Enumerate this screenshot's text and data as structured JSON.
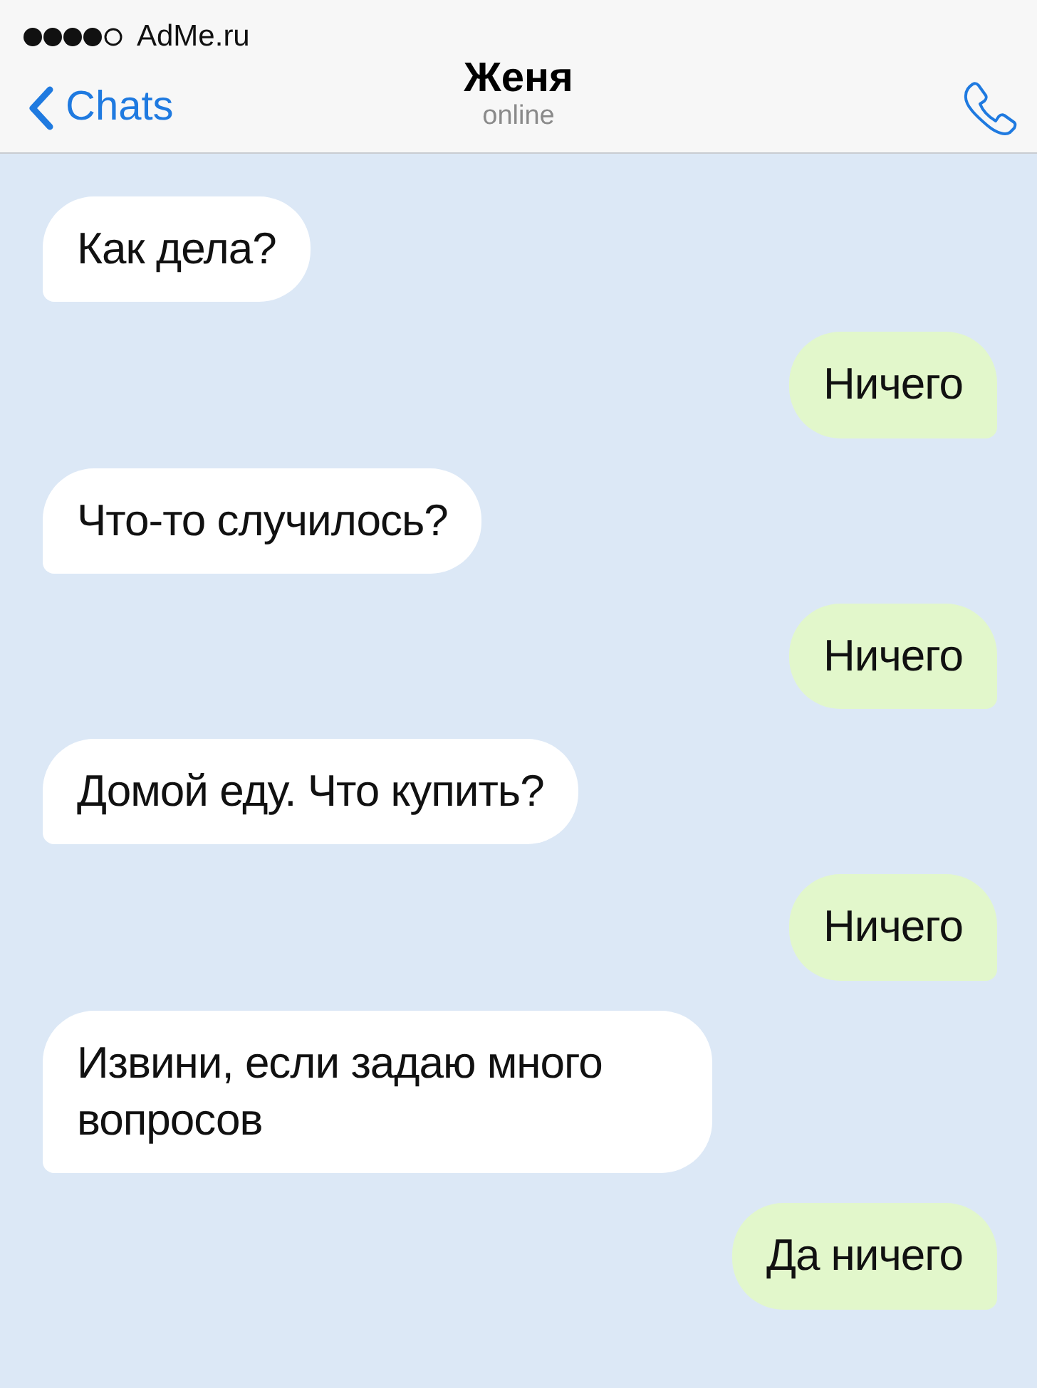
{
  "status_bar": {
    "carrier": "AdMe.ru"
  },
  "header": {
    "back_label": "Chats",
    "title": "Женя",
    "subtitle": "online"
  },
  "messages": [
    {
      "kind": "incoming",
      "text": "Как дела?"
    },
    {
      "kind": "outgoing",
      "text": "Ничего"
    },
    {
      "kind": "incoming",
      "text": "Что-то случилось?"
    },
    {
      "kind": "outgoing",
      "text": "Ничего"
    },
    {
      "kind": "incoming",
      "text": "Домой еду. Что купить?"
    },
    {
      "kind": "outgoing",
      "text": "Ничего"
    },
    {
      "kind": "incoming",
      "text": "Извини, если задаю много вопросов"
    },
    {
      "kind": "outgoing",
      "text": "Да ничего"
    }
  ]
}
